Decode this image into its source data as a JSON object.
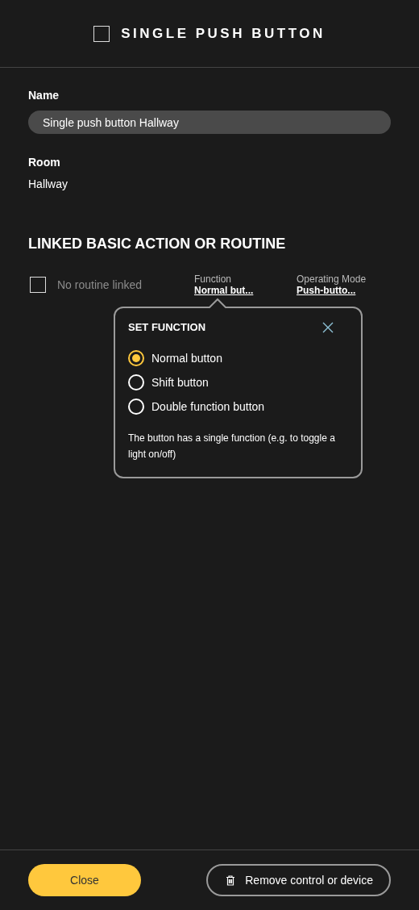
{
  "header": {
    "title": "SINGLE PUSH BUTTON"
  },
  "name_field": {
    "label": "Name",
    "value": "Single push button Hallway"
  },
  "room": {
    "label": "Room",
    "value": "Hallway"
  },
  "section_title": "LINKED BASIC ACTION OR ROUTINE",
  "routine": {
    "label": "No routine linked",
    "checked": false
  },
  "settings": [
    {
      "label": "Function",
      "value": "Normal but..."
    },
    {
      "label": "Operating Mode",
      "value": "Push-butto..."
    }
  ],
  "popover": {
    "title": "SET FUNCTION",
    "options": [
      {
        "label": "Normal button",
        "selected": true
      },
      {
        "label": "Shift button",
        "selected": false
      },
      {
        "label": "Double function button",
        "selected": false
      }
    ],
    "description": "The button has a single function (e.g. to toggle a light on/off)"
  },
  "footer": {
    "close": "Close",
    "remove": "Remove control or device"
  }
}
